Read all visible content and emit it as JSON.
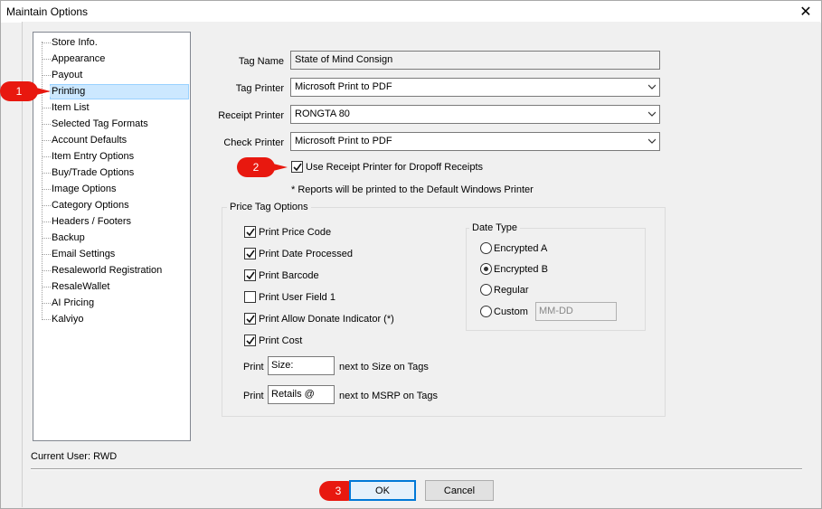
{
  "window": {
    "title": "Maintain Options",
    "close_glyph": "✕"
  },
  "tree": {
    "items": [
      {
        "label": "Store Info."
      },
      {
        "label": "Appearance"
      },
      {
        "label": "Payout"
      },
      {
        "label": "Printing",
        "selected": true
      },
      {
        "label": "Item List"
      },
      {
        "label": "Selected Tag Formats"
      },
      {
        "label": "Account Defaults"
      },
      {
        "label": "Item Entry Options"
      },
      {
        "label": "Buy/Trade Options"
      },
      {
        "label": "Image Options"
      },
      {
        "label": "Category Options"
      },
      {
        "label": "Headers / Footers"
      },
      {
        "label": "Backup"
      },
      {
        "label": "Email Settings"
      },
      {
        "label": "Resaleworld Registration"
      },
      {
        "label": "ResaleWallet"
      },
      {
        "label": "AI Pricing"
      },
      {
        "label": "Kalviyo"
      }
    ]
  },
  "callouts": {
    "one": "1",
    "two": "2",
    "three": "3",
    "color": "#e8180f"
  },
  "form": {
    "tag_name_label": "Tag Name",
    "tag_name_value": "State of Mind Consign",
    "tag_printer_label": "Tag Printer",
    "tag_printer_value": "Microsoft Print to PDF",
    "receipt_printer_label": "Receipt Printer",
    "receipt_printer_value": "RONGTA 80",
    "check_printer_label": "Check Printer",
    "check_printer_value": "Microsoft Print to PDF",
    "use_receipt_label": "Use Receipt Printer for Dropoff Receipts",
    "use_receipt_checked": true,
    "reports_note": "* Reports will be printed to the Default Windows Printer"
  },
  "price_tag_options": {
    "title": "Price Tag Options",
    "checks": [
      {
        "label": "Print Price Code",
        "checked": true
      },
      {
        "label": "Print Date Processed",
        "checked": true
      },
      {
        "label": "Print Barcode",
        "checked": true
      },
      {
        "label": "Print User Field 1",
        "checked": false
      },
      {
        "label": "Print Allow Donate Indicator (*)",
        "checked": true
      },
      {
        "label": "Print Cost",
        "checked": true
      }
    ],
    "print_label": "Print",
    "size_value": "Size:",
    "size_suffix": "next to Size on Tags",
    "retail_value": "Retails @",
    "retail_suffix": "next to MSRP on Tags"
  },
  "date_type": {
    "title": "Date Type",
    "options": [
      {
        "label": "Encrypted A",
        "selected": false
      },
      {
        "label": "Encrypted B",
        "selected": true
      },
      {
        "label": "Regular",
        "selected": false
      },
      {
        "label": "Custom",
        "selected": false
      }
    ],
    "custom_placeholder": "MM-DD"
  },
  "footer": {
    "current_user": "Current User: RWD",
    "ok_label": "OK",
    "cancel_label": "Cancel"
  }
}
